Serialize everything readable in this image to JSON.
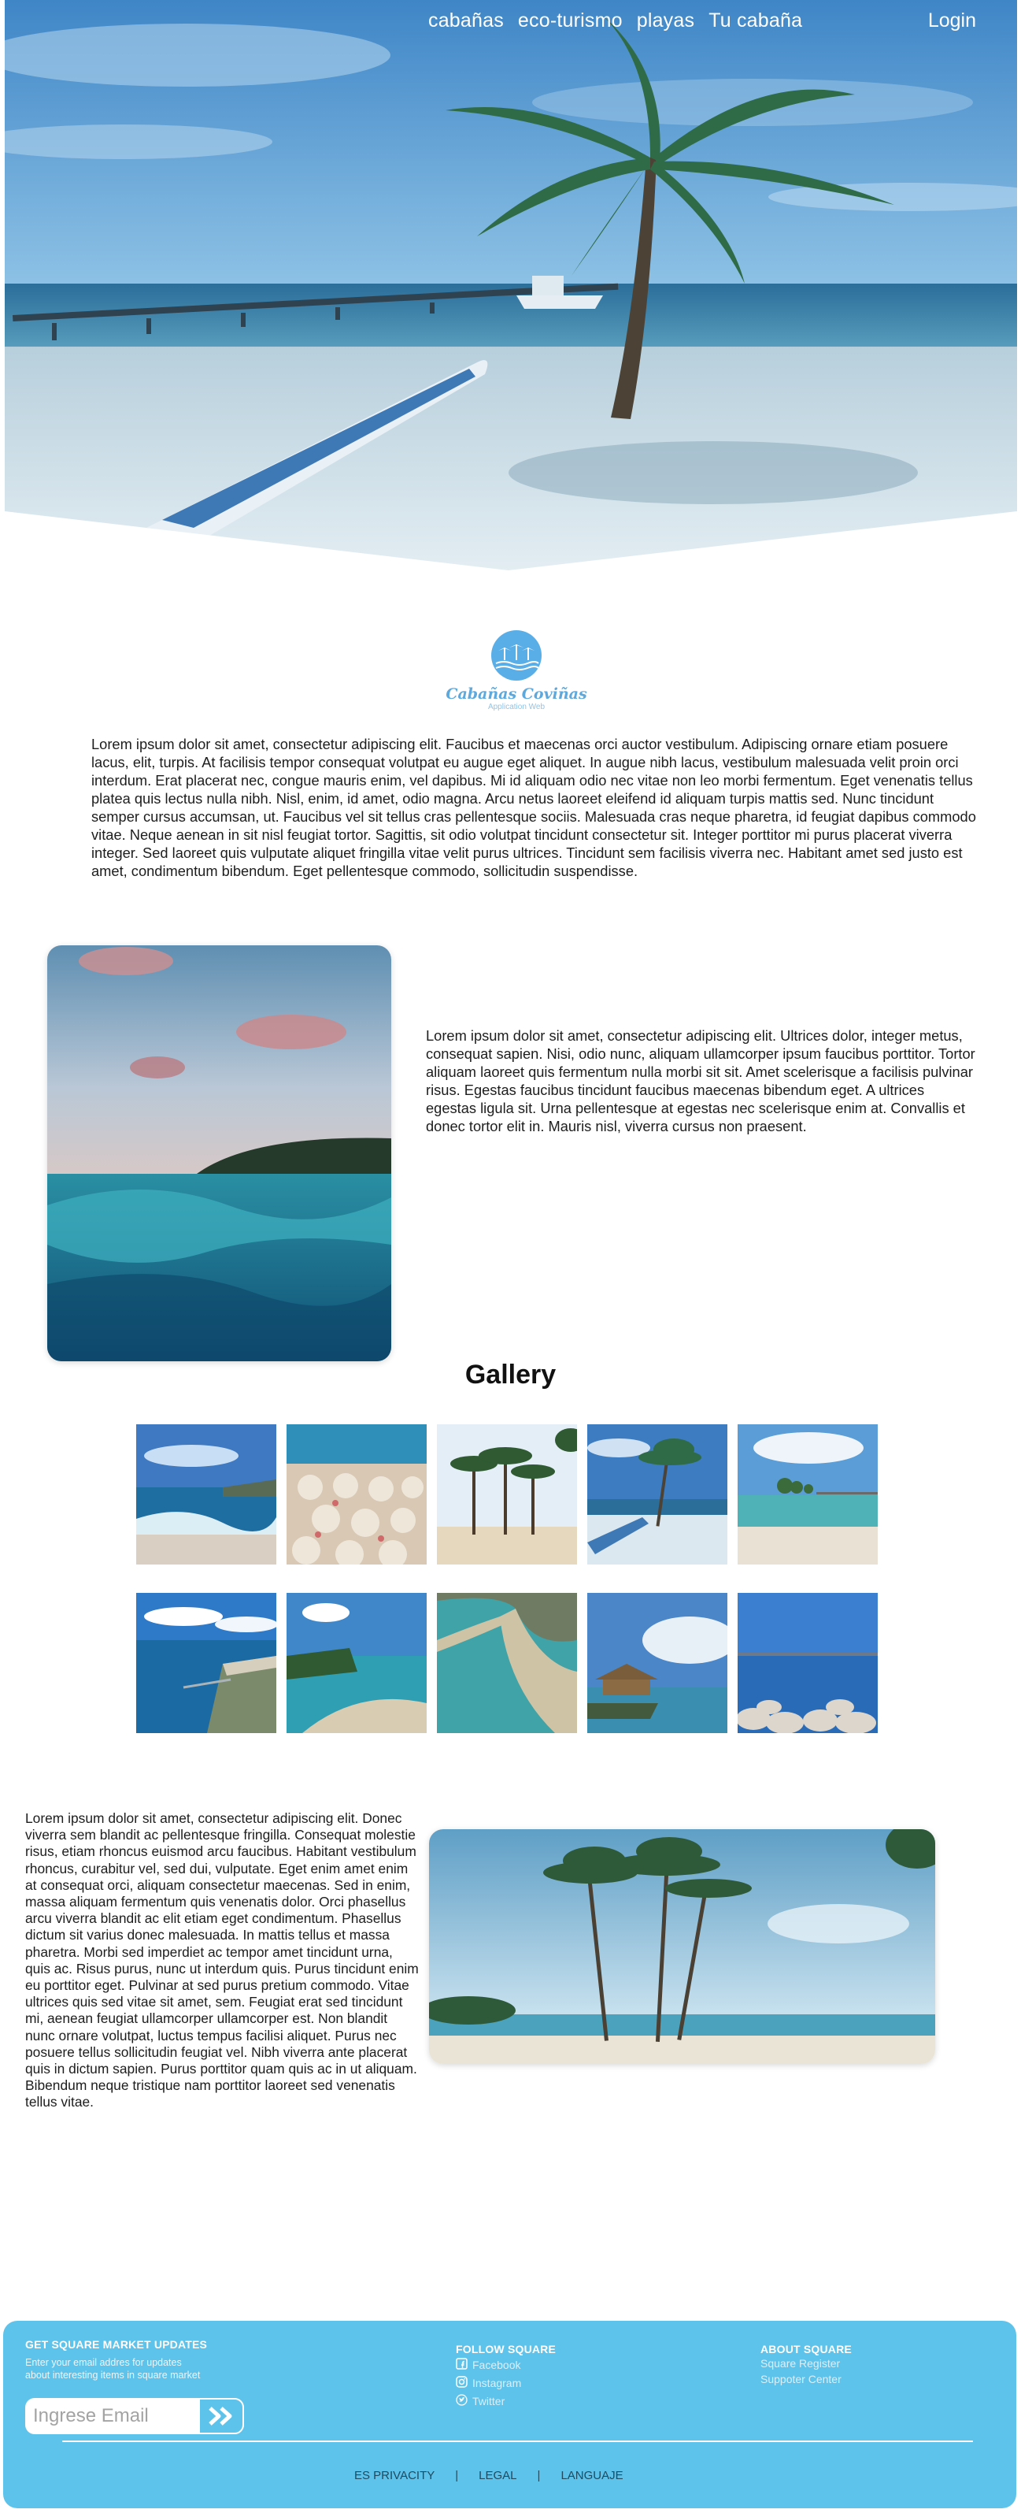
{
  "nav": {
    "links": [
      "cabañas",
      "eco-turismo",
      "playas",
      "Tu cabaña"
    ],
    "login": "Login"
  },
  "logo": {
    "name": "Cabañas Coviñas",
    "subtitle": "Application Web"
  },
  "intro_text": "Lorem ipsum dolor sit amet, consectetur adipiscing elit. Faucibus et maecenas orci auctor vestibulum. Adipiscing ornare etiam posuere lacus, elit, turpis. At facilisis tempor consequat volutpat eu augue eget aliquet. In augue nibh lacus, vestibulum malesuada velit proin orci interdum. Erat placerat nec, congue mauris enim, vel dapibus. Mi id aliquam odio nec vitae non leo morbi fermentum. Eget venenatis tellus platea quis lectus nulla nibh. Nisl, enim, id amet, odio magna. Arcu netus laoreet eleifend id aliquam turpis mattis sed. Nunc tincidunt semper cursus accumsan, ut. Faucibus vel sit tellus cras pellentesque sociis. Malesuada cras neque pharetra, id feugiat dapibus commodo vitae. Neque aenean in sit nisl feugiat tortor. Sagittis, sit odio volutpat tincidunt consectetur sit. Integer porttitor mi purus placerat viverra integer. Sed laoreet quis vulputate aliquet fringilla vitae velit purus ultrices. Tincidunt sem facilisis viverra nec. Habitant amet sed justo est amet, condimentum bibendum. Eget pellentesque commodo, sollicitudin suspendisse.",
  "section2_text": "Lorem ipsum dolor sit amet, consectetur adipiscing elit. Ultrices dolor, integer metus, consequat sapien. Nisi, odio nunc, aliquam ullamcorper ipsum faucibus porttitor. Tortor aliquam laoreet quis fermentum nulla morbi sit sit. Amet scelerisque a facilisis pulvinar risus. Egestas faucibus tincidunt faucibus maecenas bibendum eget. A ultrices egestas ligula sit. Urna pellentesque at egestas nec scelerisque enim at. Convallis et donec tortor elit in. Mauris nisl, viverra cursus non praesent.",
  "gallery": {
    "title": "Gallery",
    "items": [
      "beach-waves",
      "umbrellas",
      "palm-trees",
      "palm-boat",
      "dock-beach",
      "aerial-coast",
      "beach-trees",
      "aerial-bay",
      "hut-pier",
      "bridge-rocks"
    ]
  },
  "section3_text": "Lorem ipsum dolor sit amet, consectetur adipiscing elit. Donec viverra sem blandit ac pellentesque fringilla. Consequat molestie risus, etiam rhoncus euismod arcu faucibus. Habitant vestibulum rhoncus, curabitur vel, sed dui, vulputate. Eget enim amet enim at consequat orci, aliquam consectetur maecenas. Sed in enim, massa aliquam fermentum quis venenatis dolor. Orci phasellus arcu viverra blandit ac elit etiam eget condimentum. Phasellus dictum sit varius donec malesuada. In mattis tellus et massa pharetra. Morbi sed imperdiet ac tempor amet tincidunt urna, quis ac. Risus purus, nunc ut interdum quis. Purus tincidunt enim eu porttitor eget. Pulvinar at sed purus pretium commodo. Vitae ultrices quis sed vitae sit amet, sem. Feugiat erat sed tincidunt mi, aenean feugiat ullamcorper ullamcorper est. Non blandit nunc ornare volutpat, luctus tempus facilisi aliquet. Purus nec posuere tellus sollicitudin feugiat vel. Nibh viverra ante placerat quis in dictum sapien. Purus porttitor quam quis ac in ut aliquam. Bibendum neque tristique nam porttitor laoreet sed venenatis tellus vitae.",
  "footer": {
    "updates_title": "GET SQUARE MARKET UPDATES",
    "updates_desc_1": "Enter your email addres for updates",
    "updates_desc_2": "about interesting items in square market",
    "email_placeholder": "Ingrese Email",
    "follow_title": "FOLLOW SQUARE",
    "social": [
      "Facebook",
      "Instagram",
      "Twitter"
    ],
    "about_title": "ABOUT SQUARE",
    "about_links": [
      "Square Register",
      "Suppoter Center"
    ],
    "bottom_links": [
      "ES PRIVACITY",
      "LEGAL",
      "LANGUAJE"
    ],
    "separator": "|"
  },
  "colors": {
    "footer_bg": "#5ec3ea",
    "logo_blue": "#5aaee8",
    "hero_sky": "#4b93cf"
  }
}
